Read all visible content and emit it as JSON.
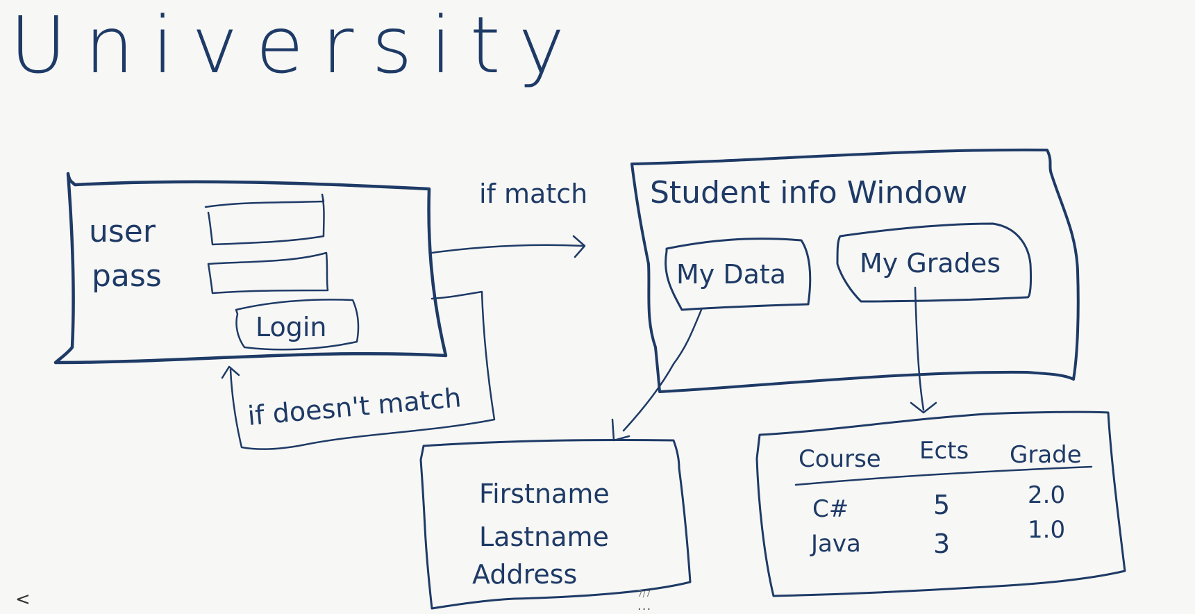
{
  "title": "University",
  "login_window": {
    "user_label": "user",
    "pass_label": "pass",
    "login_button": "Login"
  },
  "arrows": {
    "if_match": "if match",
    "if_doesnt_match": "if doesn't match"
  },
  "student_window": {
    "title": "Student info Window",
    "my_data_button": "My Data",
    "my_grades_button": "My Grades"
  },
  "data_window": {
    "fields": [
      "Firstname",
      "Lastname",
      "Address"
    ]
  },
  "grades_window": {
    "headers": [
      "Course",
      "Ects",
      "Grade"
    ],
    "rows": [
      {
        "course": "C#",
        "ects": "5",
        "grade": "2.0"
      },
      {
        "course": "Java",
        "ects": "3",
        "grade": "1.0"
      }
    ]
  },
  "footer": {
    "prev": "<",
    "page": "7/7",
    "more": "..."
  },
  "colors": {
    "ink": "#1e3a66",
    "background": "#f7f7f5"
  }
}
